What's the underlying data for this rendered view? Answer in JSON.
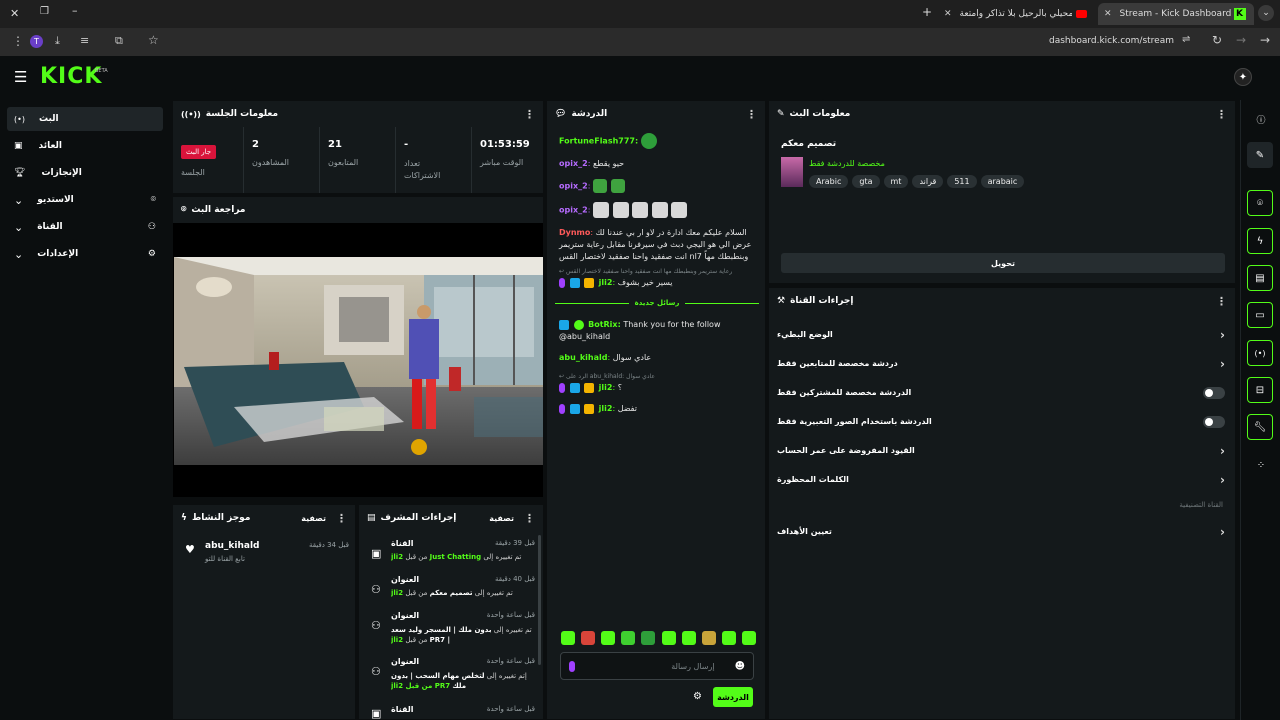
{
  "browser": {
    "tabs": [
      {
        "title": "Stream - Kick Dashboard",
        "active": true
      },
      {
        "title": "اسمحيلي بالرحيل بلا تذاكر وأمتعة",
        "active": false
      }
    ],
    "url": "dashboard.kick.com/stream"
  },
  "header": {
    "logo": "KICK",
    "beta": "BETA"
  },
  "sidebar": {
    "items": [
      {
        "label": "البث"
      },
      {
        "label": "العائد"
      },
      {
        "label": "الإنجازات"
      },
      {
        "label": "الاستديو"
      },
      {
        "label": "القناة"
      },
      {
        "label": "الإعدادات"
      }
    ]
  },
  "session": {
    "title": "معلومات الجلسة",
    "stats": [
      {
        "value": "01:53:59",
        "label": "الوقت مباشر"
      },
      {
        "value": "-",
        "label": "تعداد الاشتراكات"
      },
      {
        "value": "21",
        "label": "المتابعون"
      },
      {
        "value": "2",
        "label": "المشاهدون"
      }
    ],
    "live_badge": "جار البث",
    "session_label": "الجلسة"
  },
  "preview": {
    "title": "مراجعة البث"
  },
  "activity": {
    "title": "موجز النشاط",
    "filter": "تصفية",
    "item": {
      "user": "abu_kihald",
      "text": "تابع القناة للتو",
      "time": "قبل 34 دقيقة"
    }
  },
  "modactions": {
    "title": "إجراءات المشرف",
    "filter": "تصفية",
    "items": [
      {
        "kind": "القناة",
        "time": "قبل 39 دقيقة",
        "pre": "تم تغييره إلى",
        "value": "Just Chatting",
        "mid": "من قبل",
        "user": "jli2"
      },
      {
        "kind": "العنوان",
        "time": "قبل 40 دقيقة",
        "pre": "تم تغييره إلى",
        "value": "تصميم معكم",
        "mid": "من قبل",
        "user": "jli2"
      },
      {
        "kind": "العنوان",
        "time": "قبل ساعة واحدة",
        "pre": "تم تغييره إلى",
        "value": "بدون ملك | المسجر وليد سعد | PR7",
        "mid": "من قبل",
        "user": "jli2"
      },
      {
        "kind": "العنوان",
        "time": "قبل ساعة واحدة",
        "pre": "إتم تغييره إلى",
        "value": "لتخلص مهام السحب | بدون ملك",
        "mid": "من قبل",
        "user": "PR7 من قبل jli2"
      },
      {
        "kind": "القناة",
        "time": "قبل ساعة واحدة",
        "pre": "",
        "value": "",
        "mid": "",
        "user": ""
      }
    ]
  },
  "chat": {
    "title": "الدردشة",
    "messages": [
      {
        "user": "FortuneFlash777",
        "text": ""
      },
      {
        "user": "opix_2",
        "text": "حيو يقطع"
      },
      {
        "user": "opix_2",
        "text": ""
      },
      {
        "user": "opix_2",
        "text": ""
      },
      {
        "user": "Dynmo",
        "text": "السلام عليكم معك ادارة در لاو ار بي عندنا لك عرض الي هو اليجي دبث في سيرفرنا مقابل رعاية ستريمر وبنطبطك مهاً nl7 انت صفقيد واحنا صفقيد لاختصار القس"
      },
      {
        "user": "jli2",
        "text": "يسير خير بشوف"
      }
    ],
    "reply_preview": "رعاية ستريمر وبنطبطك مهاً انت صفقيد واحنا صفقيد لاختصار القس",
    "divider": "رسائل جديدة",
    "messages2": [
      {
        "user": "BotRix",
        "text": "Thank you for the follow @abu_kihald"
      },
      {
        "user": "abu_kihald",
        "text": "عادي سوال"
      }
    ],
    "reply_to": "الرد على abu_kihald: عادي سوال",
    "messages3": [
      {
        "user": "jli2",
        "text": "؟"
      },
      {
        "user": "jli2",
        "text": "تفضل"
      }
    ],
    "placeholder": "إرسال رسالة",
    "send": "الدردشة"
  },
  "streaminfo": {
    "title": "معلومات البث",
    "name": "تصميم معكم",
    "category": "مخصصة للدردشة فقط",
    "tags": [
      "arabaic",
      "511",
      "قراند",
      "mt",
      "gta",
      "Arabic"
    ],
    "edit": "تحويل"
  },
  "channelactions": {
    "title": "إجراءات القناة",
    "rows": [
      {
        "label": "الوضع البطيء",
        "type": "chevron"
      },
      {
        "label": "دردشة مخصصة للمتابعين فقط",
        "type": "chevron"
      },
      {
        "label": "الدردشة مخصصة للمشتركين فقط",
        "type": "toggle"
      },
      {
        "label": "الدردشة باستخدام الصور التعبيرية فقط",
        "type": "toggle"
      },
      {
        "label": "القيود المفروضة على عمر الحساب",
        "type": "chevron"
      },
      {
        "label": "الكلمات المحظورة",
        "type": "chevron"
      }
    ],
    "section": "القناة التصنيفية",
    "goals": "تعيين الأهداف"
  }
}
